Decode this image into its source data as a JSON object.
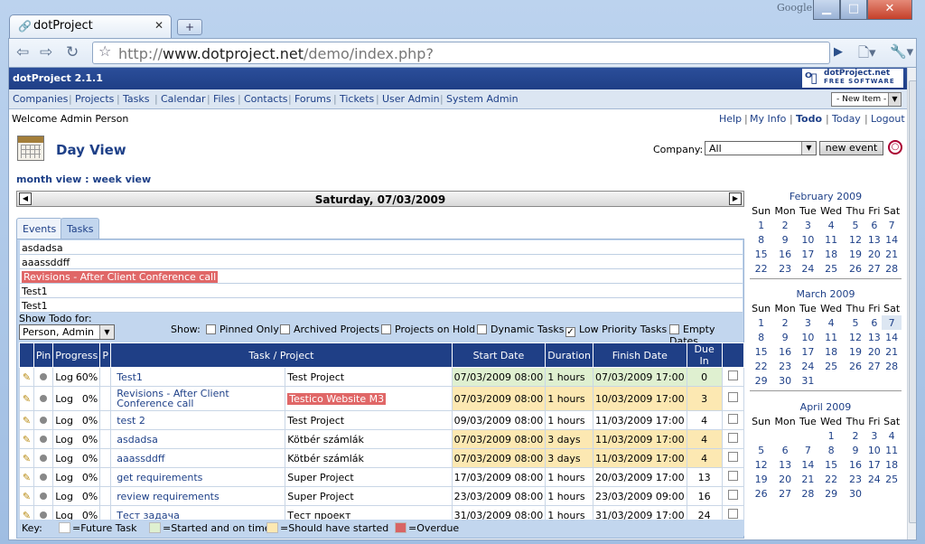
{
  "browser": {
    "tab_title": "dotProject",
    "brand": "Google",
    "url_prefix": "http://",
    "url_domain": "www.dotproject.net",
    "url_path": "/demo/index.php?"
  },
  "app": {
    "title": "dotProject 2.1.1",
    "logo_line1": "dotProject.net",
    "logo_line2": "FREE SOFTWARE",
    "menu": [
      "Companies",
      "Projects",
      "Tasks",
      "Calendar",
      "Files",
      "Contacts",
      "Forums",
      "Tickets",
      "User Admin",
      "System Admin"
    ],
    "new_item": "- New Item -",
    "welcome": "Welcome Admin Person",
    "user_links": [
      "Help",
      "My Info",
      "Todo",
      "Today",
      "Logout"
    ]
  },
  "page": {
    "title": "Day View",
    "company_label": "Company:",
    "company_value": "All",
    "new_event": "new event",
    "view_links": "month view : week view",
    "date": "Saturday, 07/03/2009",
    "tabs": [
      "Events",
      "Tasks"
    ],
    "task_list": [
      "asdadsa",
      "aaassddff",
      "Revisions - After Client Conference call",
      "Test1",
      "Test1"
    ],
    "show_todo_label": "Show Todo for:",
    "show_todo_value": "Person, Admin",
    "show_label": "Show:",
    "filters": [
      {
        "label": "Pinned Only",
        "checked": false
      },
      {
        "label": "Archived Projects",
        "checked": false
      },
      {
        "label": "Projects on Hold",
        "checked": false
      },
      {
        "label": "Dynamic Tasks",
        "checked": false
      },
      {
        "label": "Low Priority Tasks",
        "checked": true
      },
      {
        "label": "Empty Dates",
        "checked": false
      }
    ],
    "columns": [
      "",
      "Pin",
      "Progress",
      "P",
      "Task / Project",
      "",
      "Start Date",
      "Duration",
      "Finish Date",
      "Due In",
      ""
    ],
    "tasks": [
      {
        "log": "Log",
        "progress": "60%",
        "task": "Test1",
        "project": "Test Project",
        "project_overdue": false,
        "start": "07/03/2009 08:00",
        "duration": "1 hours",
        "finish": "07/03/2009 17:00",
        "due": "0",
        "status": "started"
      },
      {
        "log": "Log",
        "progress": "0%",
        "task": "Revisions - After Client Conference call",
        "project": "Testico Website M3",
        "project_overdue": true,
        "start": "07/03/2009 08:00",
        "duration": "1 hours",
        "finish": "10/03/2009 17:00",
        "due": "3",
        "status": "should"
      },
      {
        "log": "Log",
        "progress": "0%",
        "task": "test 2",
        "project": "Test Project",
        "project_overdue": false,
        "start": "09/03/2009 08:00",
        "duration": "1 hours",
        "finish": "11/03/2009 17:00",
        "due": "4",
        "status": "future"
      },
      {
        "log": "Log",
        "progress": "0%",
        "task": "asdadsa",
        "project": "Kötbér számlák",
        "project_overdue": false,
        "start": "07/03/2009 08:00",
        "duration": "3 days",
        "finish": "11/03/2009 17:00",
        "due": "4",
        "status": "should"
      },
      {
        "log": "Log",
        "progress": "0%",
        "task": "aaassddff",
        "project": "Kötbér számlák",
        "project_overdue": false,
        "start": "07/03/2009 08:00",
        "duration": "3 days",
        "finish": "11/03/2009 17:00",
        "due": "4",
        "status": "should"
      },
      {
        "log": "Log",
        "progress": "0%",
        "task": "get requirements",
        "project": "Super Project",
        "project_overdue": false,
        "start": "17/03/2009 08:00",
        "duration": "1 hours",
        "finish": "20/03/2009 17:00",
        "due": "13",
        "status": "future"
      },
      {
        "log": "Log",
        "progress": "0%",
        "task": "review requirements",
        "project": "Super Project",
        "project_overdue": false,
        "start": "23/03/2009 08:00",
        "duration": "1 hours",
        "finish": "23/03/2009 09:00",
        "due": "16",
        "status": "future"
      },
      {
        "log": "Log",
        "progress": "0%",
        "task": "Тест задача",
        "project": "Тест проект",
        "project_overdue": false,
        "start": "31/03/2009 08:00",
        "duration": "1 hours",
        "finish": "31/03/2009 17:00",
        "due": "24",
        "status": "future"
      }
    ],
    "key": {
      "label": "Key:",
      "items": [
        {
          "label": "=Future Task",
          "color": "#ffffff"
        },
        {
          "label": "=Started and on time",
          "color": "#dff0d0"
        },
        {
          "label": "=Should have started",
          "color": "#fce8b2"
        },
        {
          "label": "=Overdue",
          "color": "#d86464"
        }
      ]
    }
  },
  "calendars": [
    {
      "title": "February 2009",
      "days": [
        "Sun",
        "Mon",
        "Tue",
        "Wed",
        "Thu",
        "Fri",
        "Sat"
      ],
      "weeks": [
        [
          "1",
          "2",
          "3",
          "4",
          "5",
          "6",
          "7"
        ],
        [
          "8",
          "9",
          "10",
          "11",
          "12",
          "13",
          "14"
        ],
        [
          "15",
          "16",
          "17",
          "18",
          "19",
          "20",
          "21"
        ],
        [
          "22",
          "23",
          "24",
          "25",
          "26",
          "27",
          "28"
        ]
      ]
    },
    {
      "title": "March 2009",
      "days": [
        "Sun",
        "Mon",
        "Tue",
        "Wed",
        "Thu",
        "Fri",
        "Sat"
      ],
      "weeks": [
        [
          "1",
          "2",
          "3",
          "4",
          "5",
          "6",
          "7"
        ],
        [
          "8",
          "9",
          "10",
          "11",
          "12",
          "13",
          "14"
        ],
        [
          "15",
          "16",
          "17",
          "18",
          "19",
          "20",
          "21"
        ],
        [
          "22",
          "23",
          "24",
          "25",
          "26",
          "27",
          "28"
        ],
        [
          "29",
          "30",
          "31",
          "",
          "",
          "",
          ""
        ]
      ],
      "selected": "7"
    },
    {
      "title": "April 2009",
      "days": [
        "Sun",
        "Mon",
        "Tue",
        "Wed",
        "Thu",
        "Fri",
        "Sat"
      ],
      "weeks": [
        [
          "",
          "",
          "",
          "1",
          "2",
          "3",
          "4"
        ],
        [
          "5",
          "6",
          "7",
          "8",
          "9",
          "10",
          "11"
        ],
        [
          "12",
          "13",
          "14",
          "15",
          "16",
          "17",
          "18"
        ],
        [
          "19",
          "20",
          "21",
          "22",
          "23",
          "24",
          "25"
        ],
        [
          "26",
          "27",
          "28",
          "29",
          "30",
          "",
          ""
        ]
      ]
    }
  ],
  "colors": {
    "header_blue": "#1f3f86",
    "link_blue": "#1e4088",
    "panel_blue": "#c2d6ee",
    "overdue": "#e06767"
  }
}
